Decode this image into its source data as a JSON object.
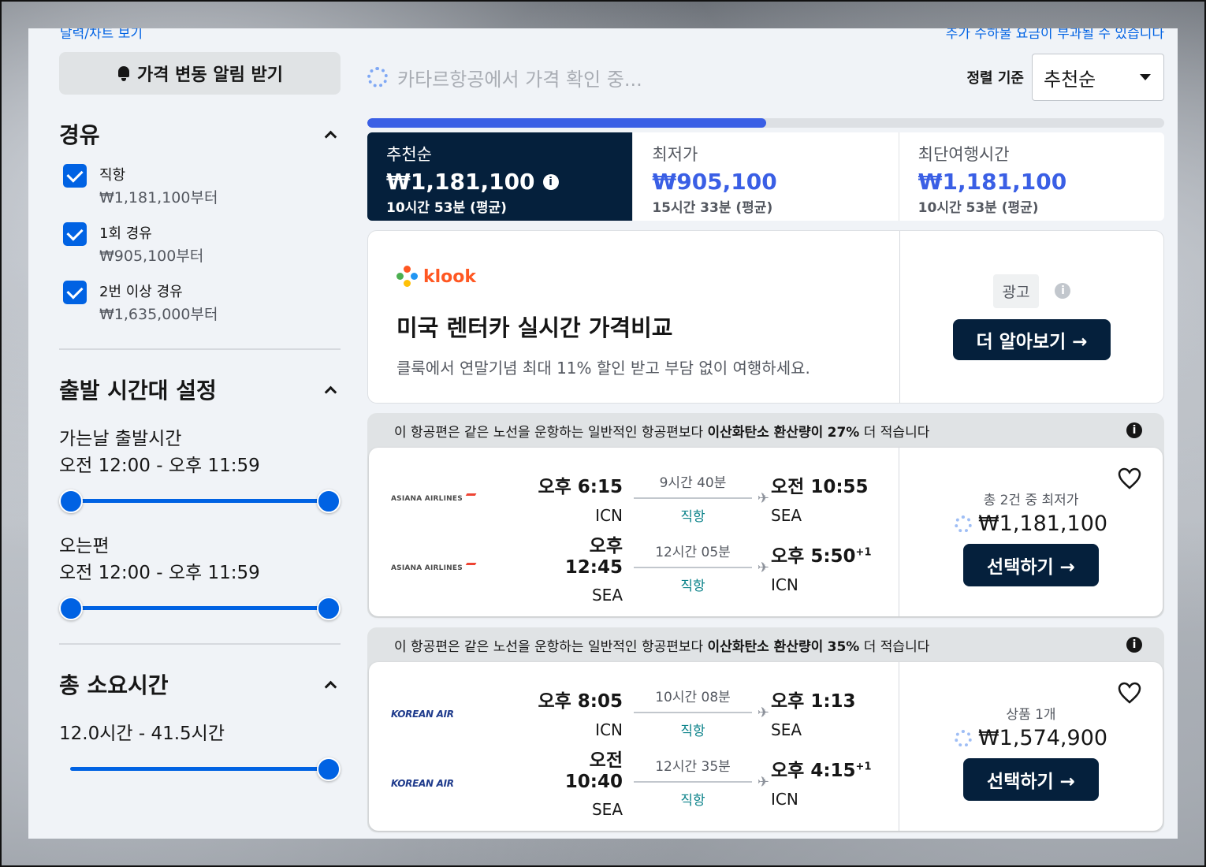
{
  "top": {
    "left_link": "달력/차트 보기",
    "right_note": "추가 수하물 요금이 부과될 수 있습니다"
  },
  "sidebar": {
    "alert_button": "가격 변동 알림 받기",
    "stops": {
      "title": "경유",
      "options": [
        {
          "label": "직항",
          "price": "₩1,181,100부터",
          "checked": true
        },
        {
          "label": "1회 경유",
          "price": "₩905,100부터",
          "checked": true
        },
        {
          "label": "2번 이상 경유",
          "price": "₩1,635,000부터",
          "checked": true
        }
      ]
    },
    "departure": {
      "title": "출발 시간대 설정",
      "outbound_label": "가는날 출발시간",
      "outbound_range": "오전 12:00 - 오후 11:59",
      "return_label": "오는편",
      "return_range": "오전 12:00 - 오후 11:59"
    },
    "duration": {
      "title": "총 소요시간",
      "range": "12.0시간 - 41.5시간"
    }
  },
  "main": {
    "loading_text": "카타르항공에서 가격 확인 중...",
    "sort_label": "정렬 기준",
    "sort_value": "추천순",
    "progress": 0.5,
    "tabs": [
      {
        "label": "추천순",
        "price": "₩1,181,100",
        "duration": "10시간 53분 (평균)",
        "active": true
      },
      {
        "label": "최저가",
        "price": "₩905,100",
        "duration": "15시간 33분 (평균)",
        "active": false
      },
      {
        "label": "최단여행시간",
        "price": "₩1,181,100",
        "duration": "10시간 53분 (평균)",
        "active": false
      }
    ],
    "ad": {
      "brand": "klook",
      "title": "미국 렌터카 실시간 가격비교",
      "subtitle": "클룩에서 연말기념 최대 11% 할인 받고 부담 없이 여행하세요.",
      "badge": "광고",
      "button": "더 알아보기 →"
    },
    "results": [
      {
        "eco_pre": "이 항공편은 같은 노선을 운항하는 일반적인 항공편보다 ",
        "eco_bold": "이산화탄소 환산량이",
        "eco_pct": "27%",
        "eco_post": " 더 적습니다",
        "airline": "ASIANA AIRLINES",
        "legs": [
          {
            "dep_time": "오후 6:15",
            "dep_ap": "ICN",
            "duration": "9시간 40분",
            "stops": "직항",
            "arr_time": "오전 10:55",
            "arr_plus": "",
            "arr_ap": "SEA"
          },
          {
            "dep_time": "오후 12:45",
            "dep_ap": "SEA",
            "duration": "12시간 05분",
            "stops": "직항",
            "arr_time": "오후 5:50",
            "arr_plus": "+1",
            "arr_ap": "ICN"
          }
        ],
        "price_label": "총 2건 중 최저가",
        "price": "₩1,181,100",
        "button": "선택하기 →"
      },
      {
        "eco_pre": "이 항공편은 같은 노선을 운항하는 일반적인 항공편보다 ",
        "eco_bold": "이산화탄소 환산량이",
        "eco_pct": "35%",
        "eco_post": " 더 적습니다",
        "airline": "KOREAN AIR",
        "legs": [
          {
            "dep_time": "오후 8:05",
            "dep_ap": "ICN",
            "duration": "10시간 08분",
            "stops": "직항",
            "arr_time": "오후 1:13",
            "arr_plus": "",
            "arr_ap": "SEA"
          },
          {
            "dep_time": "오전 10:40",
            "dep_ap": "SEA",
            "duration": "12시간 35분",
            "stops": "직항",
            "arr_time": "오후 4:15",
            "arr_plus": "+1",
            "arr_ap": "ICN"
          }
        ],
        "price_label": "상품 1개",
        "price": "₩1,574,900",
        "button": "선택하기 →"
      }
    ]
  },
  "colors": {
    "accent": "#0062e3",
    "dark": "#05203c",
    "progress": "#3a5fe5"
  },
  "icons": {
    "alert": "bell-icon",
    "collapse": "chevron-up-icon",
    "info": "info-icon",
    "favorite": "heart-icon",
    "loading": "spinner-icon"
  }
}
